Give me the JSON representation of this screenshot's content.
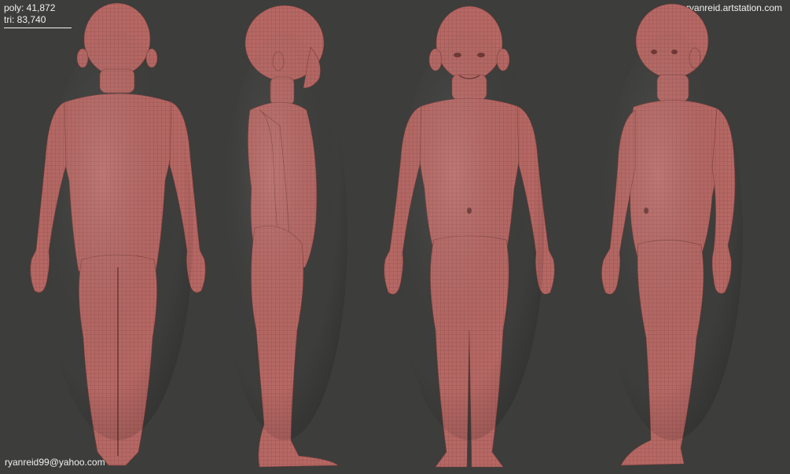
{
  "overlay": {
    "poly_label": "poly: 41,872",
    "tri_label": "tri: 83,740",
    "website": "ryanreid.artstation.com",
    "email": "ryanreid99@yahoo.com"
  },
  "colors": {
    "background": "#3d3d3b",
    "skin": "#b86a66",
    "skin_shadow": "#8e4a48",
    "text": "#f2f2f2"
  },
  "views": [
    "back-view-figure",
    "side-view-figure",
    "front-view-figure",
    "three-quarter-view-figure"
  ]
}
